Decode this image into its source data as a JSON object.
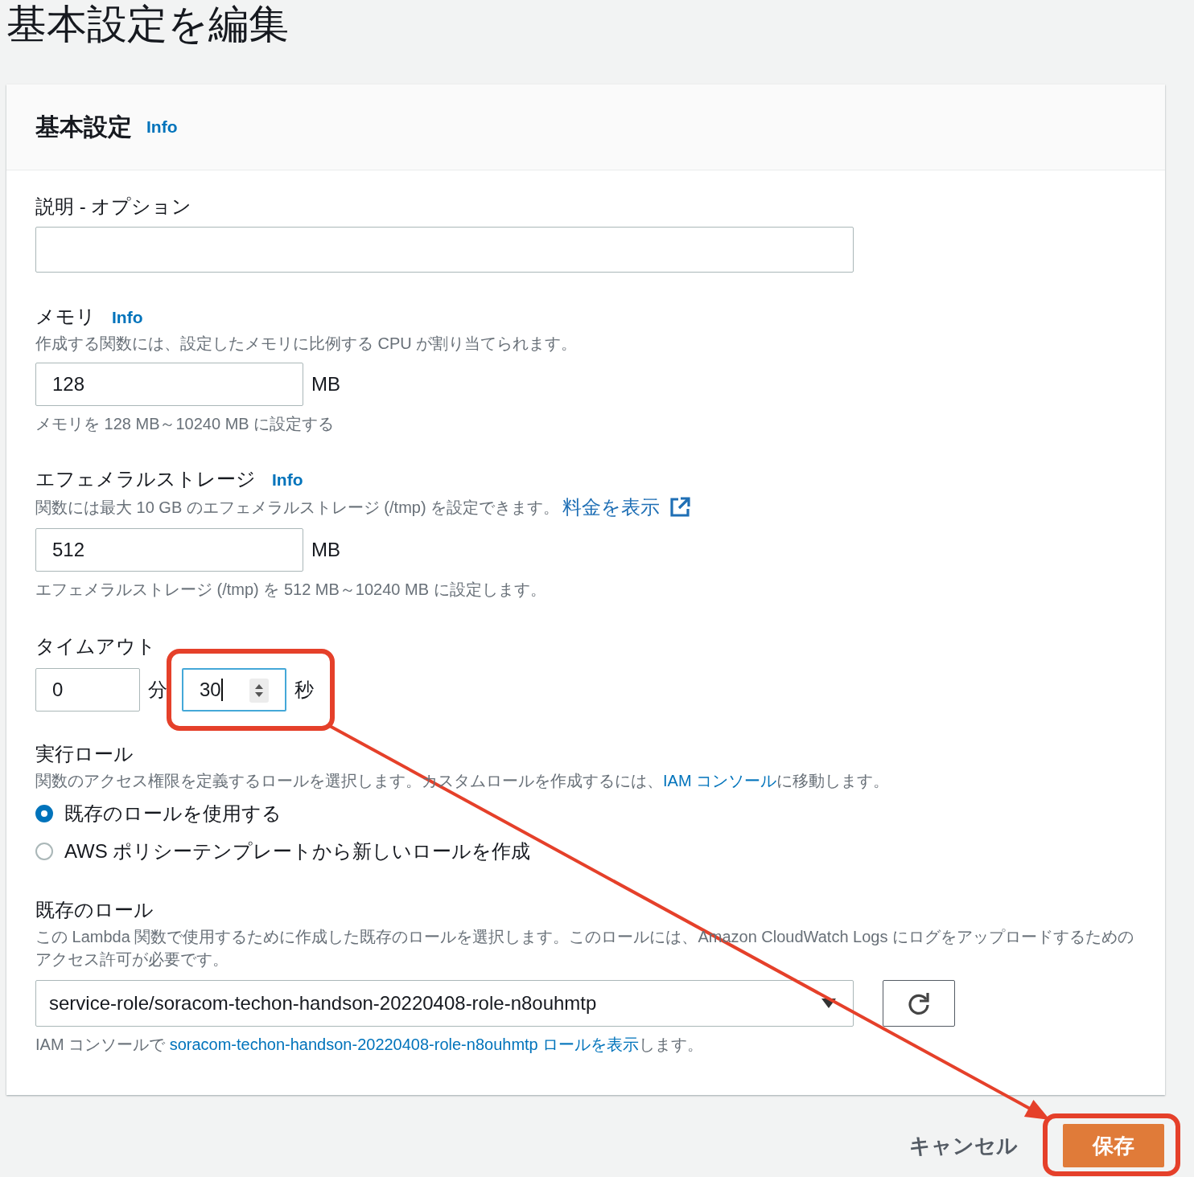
{
  "page_title": "基本設定を編集",
  "panel": {
    "title": "基本設定",
    "info_link": "Info"
  },
  "description_field": {
    "label": "説明 - オプション"
  },
  "memory": {
    "label": "メモリ",
    "info_link": "Info",
    "hint": "作成する関数には、設定したメモリに比例する CPU が割り当てられます。",
    "value": "128",
    "unit": "MB",
    "constraint": "メモリを 128 MB～10240 MB に設定する"
  },
  "ephemeral_storage": {
    "label": "エフェメラルストレージ",
    "info_link": "Info",
    "hint": "関数には最大 10 GB のエフェメラルストレージ (/tmp) を設定できます。",
    "pricing_link": "料金を表示",
    "value": "512",
    "unit": "MB",
    "constraint": "エフェメラルストレージ (/tmp) を 512 MB～10240 MB に設定します。"
  },
  "timeout": {
    "label": "タイムアウト",
    "minutes": {
      "value": "0",
      "unit": "分",
      "focused": false
    },
    "seconds": {
      "value": "30",
      "unit": "秒",
      "focused": true
    }
  },
  "execution_role": {
    "label": "実行ロール",
    "hint_before": "関数のアクセス権限を定義するロールを選択します。カスタムロールを作成するには、",
    "hint_link": "IAM コンソール",
    "hint_after": "に移動します。",
    "options": [
      {
        "label": "既存のロールを使用する",
        "selected": true
      },
      {
        "label": "AWS ポリシーテンプレートから新しいロールを作成",
        "selected": false
      }
    ]
  },
  "existing_role": {
    "label": "既存のロール",
    "hint": "この Lambda 関数で使用するために作成した既存のロールを選択します。このロールには、Amazon CloudWatch Logs にログをアップロードするためのアクセス許可が必要です。",
    "value": "service-role/soracom-techon-handson-20220408-role-n8ouhmtp",
    "note_before": "IAM コンソールで ",
    "note_link": "soracom-techon-handson-20220408-role-n8ouhmtp ロールを表示",
    "note_after": "します。"
  },
  "actions": {
    "cancel": "キャンセル",
    "save": "保存"
  }
}
